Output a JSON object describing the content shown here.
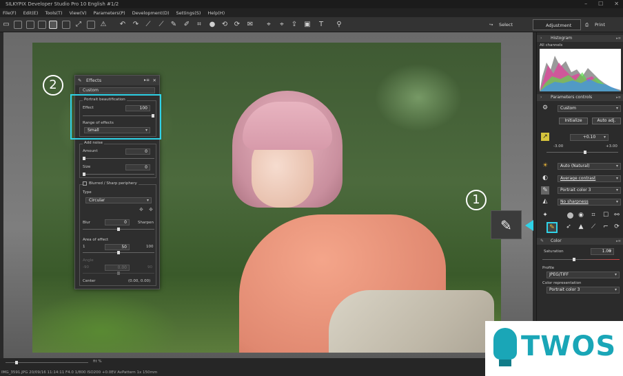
{
  "window": {
    "title": "SILKYPIX Developer Studio Pro 10 English  #1/2"
  },
  "menu": [
    "File(F)",
    "Edit(E)",
    "Tools(T)",
    "View(V)",
    "Parameters(P)",
    "Development(D)",
    "Settings(S)",
    "Help(H)"
  ],
  "toolbar": {
    "select_label": "Select",
    "adjustment_label": "Adjustment",
    "print_label": "Print"
  },
  "callouts": {
    "one": "1",
    "two": "2"
  },
  "effects_panel": {
    "title": "Effects",
    "preset": "Custom",
    "portrait": {
      "group_title": "Portrait beautification",
      "effect_label": "Effect",
      "effect_value": "100",
      "effect_level": 1.0,
      "range_label": "Range of effects",
      "range_value": "Small"
    },
    "noise": {
      "group_title": "Add noise",
      "amount_label": "Amount",
      "amount_value": "0",
      "size_label": "Size",
      "size_value": "0"
    },
    "blur": {
      "group_title": "Blurred / Sharp periphery",
      "type_label": "Type",
      "type_value": "Circular",
      "blur_label": "Blur",
      "blur_value": "0",
      "sharpen_label": "Sharpen",
      "area_label": "Area of effect",
      "area_min": "1",
      "area_value": "50",
      "area_max": "100",
      "angle_label": "Angle",
      "angle_min": "-90",
      "angle_value": "0.00",
      "angle_max": "90",
      "center_label": "Center",
      "center_value": "(0.00, 0.00)"
    }
  },
  "right_panel": {
    "histogram_title": "Histogram",
    "channels": "All channels",
    "params_title": "Parameters controls",
    "taste": "Custom",
    "initialize_label": "Initialize",
    "auto_adj_label": "Auto adj.",
    "exposure_value": "+0.10",
    "exposure_min": "-3.00",
    "exposure_max": "+3.00",
    "white_balance": "Auto (Natural)",
    "contrast": "Average contrast",
    "color_mode": "Portrait color 3",
    "sharpness": "No sharpness",
    "color_title": "Color",
    "saturation_label": "Saturation",
    "saturation_value": "1.00",
    "profile_label": "Profile",
    "profile_value": "JPEG/TIFF",
    "color_rep_label": "Color representation",
    "color_rep_value": "Portrait color 3"
  },
  "status": {
    "zoom": "fit %",
    "info": "IMG_3591.JPG 20/09/16 11:14:11 F4.0 1/800 ISO200 +0.0EV AvPattern 1x 150mm"
  },
  "watermark": {
    "text": "TWOS"
  },
  "colors": {
    "accent": "#2fd3e8",
    "logo": "#1aa6b7"
  }
}
